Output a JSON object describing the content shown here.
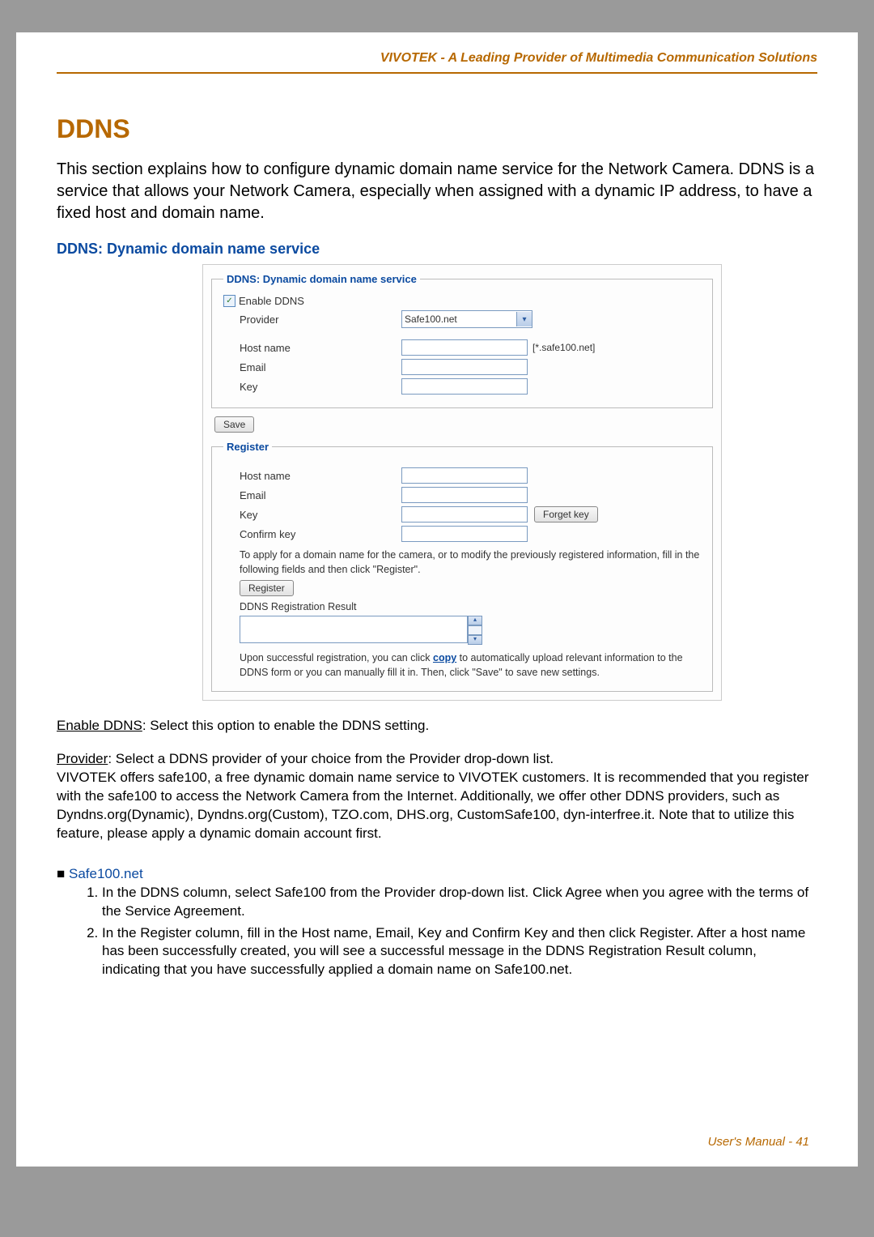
{
  "header": {
    "title": "VIVOTEK - A Leading Provider of Multimedia Communication Solutions"
  },
  "title": "DDNS",
  "intro": "This section explains how to configure dynamic domain name service for the Network Camera. DDNS is a service that allows your Network Camera, especially when assigned with a dynamic IP address, to have a fixed host and domain name.",
  "subheading": "DDNS: Dynamic domain name service",
  "panel": {
    "ddns": {
      "legend": "DDNS: Dynamic domain name service",
      "enable_label": "Enable DDNS",
      "provider_label": "Provider",
      "provider_value": "Safe100.net",
      "hostname_label": "Host name",
      "hostname_suffix": "[*.safe100.net]",
      "email_label": "Email",
      "key_label": "Key"
    },
    "save_label": "Save",
    "register": {
      "legend": "Register",
      "hostname_label": "Host name",
      "email_label": "Email",
      "key_label": "Key",
      "forget_key_label": "Forget key",
      "confirm_key_label": "Confirm key",
      "instruction": "To apply for a domain name for the camera, or to modify the previously registered information, fill in the following fields and then click \"Register\".",
      "register_btn": "Register",
      "result_label": "DDNS Registration Result",
      "success_pre": "Upon successful registration, you can click ",
      "copy_label": "copy",
      "success_post": " to automatically upload relevant information to the DDNS form or you can manually fill it in. Then, click \"Save\" to save new settings."
    }
  },
  "explain": {
    "enable_label": "Enable DDNS",
    "enable_text": ": Select this option to enable the DDNS setting.",
    "provider_label": "Provider",
    "provider_line": ": Select a DDNS provider of your choice from the Provider drop-down list.",
    "provider_para": "VIVOTEK offers safe100, a free dynamic domain name service to VIVOTEK customers. It is recommended that you register with the safe100 to access the Network Camera from the Internet. Additionally, we offer other DDNS providers, such as Dyndns.org(Dynamic), Dyndns.org(Custom), TZO.com, DHS.org, CustomSafe100, dyn-interfree.it. Note that to utilize this feature, please apply a dynamic domain account first."
  },
  "safe100": {
    "heading": "Safe100.net",
    "step1": "In the DDNS column, select Safe100 from the Provider drop-down list. Click Agree when you agree with the terms of the Service Agreement.",
    "step2": "In the Register column, fill in the Host name, Email, Key and Confirm Key and then click Register. After a host name has been successfully created, you will see a successful message in the DDNS Registration Result column, indicating that you have successfully applied a domain name on Safe100.net."
  },
  "footer": {
    "label": "User's Manual - ",
    "page": "41"
  }
}
